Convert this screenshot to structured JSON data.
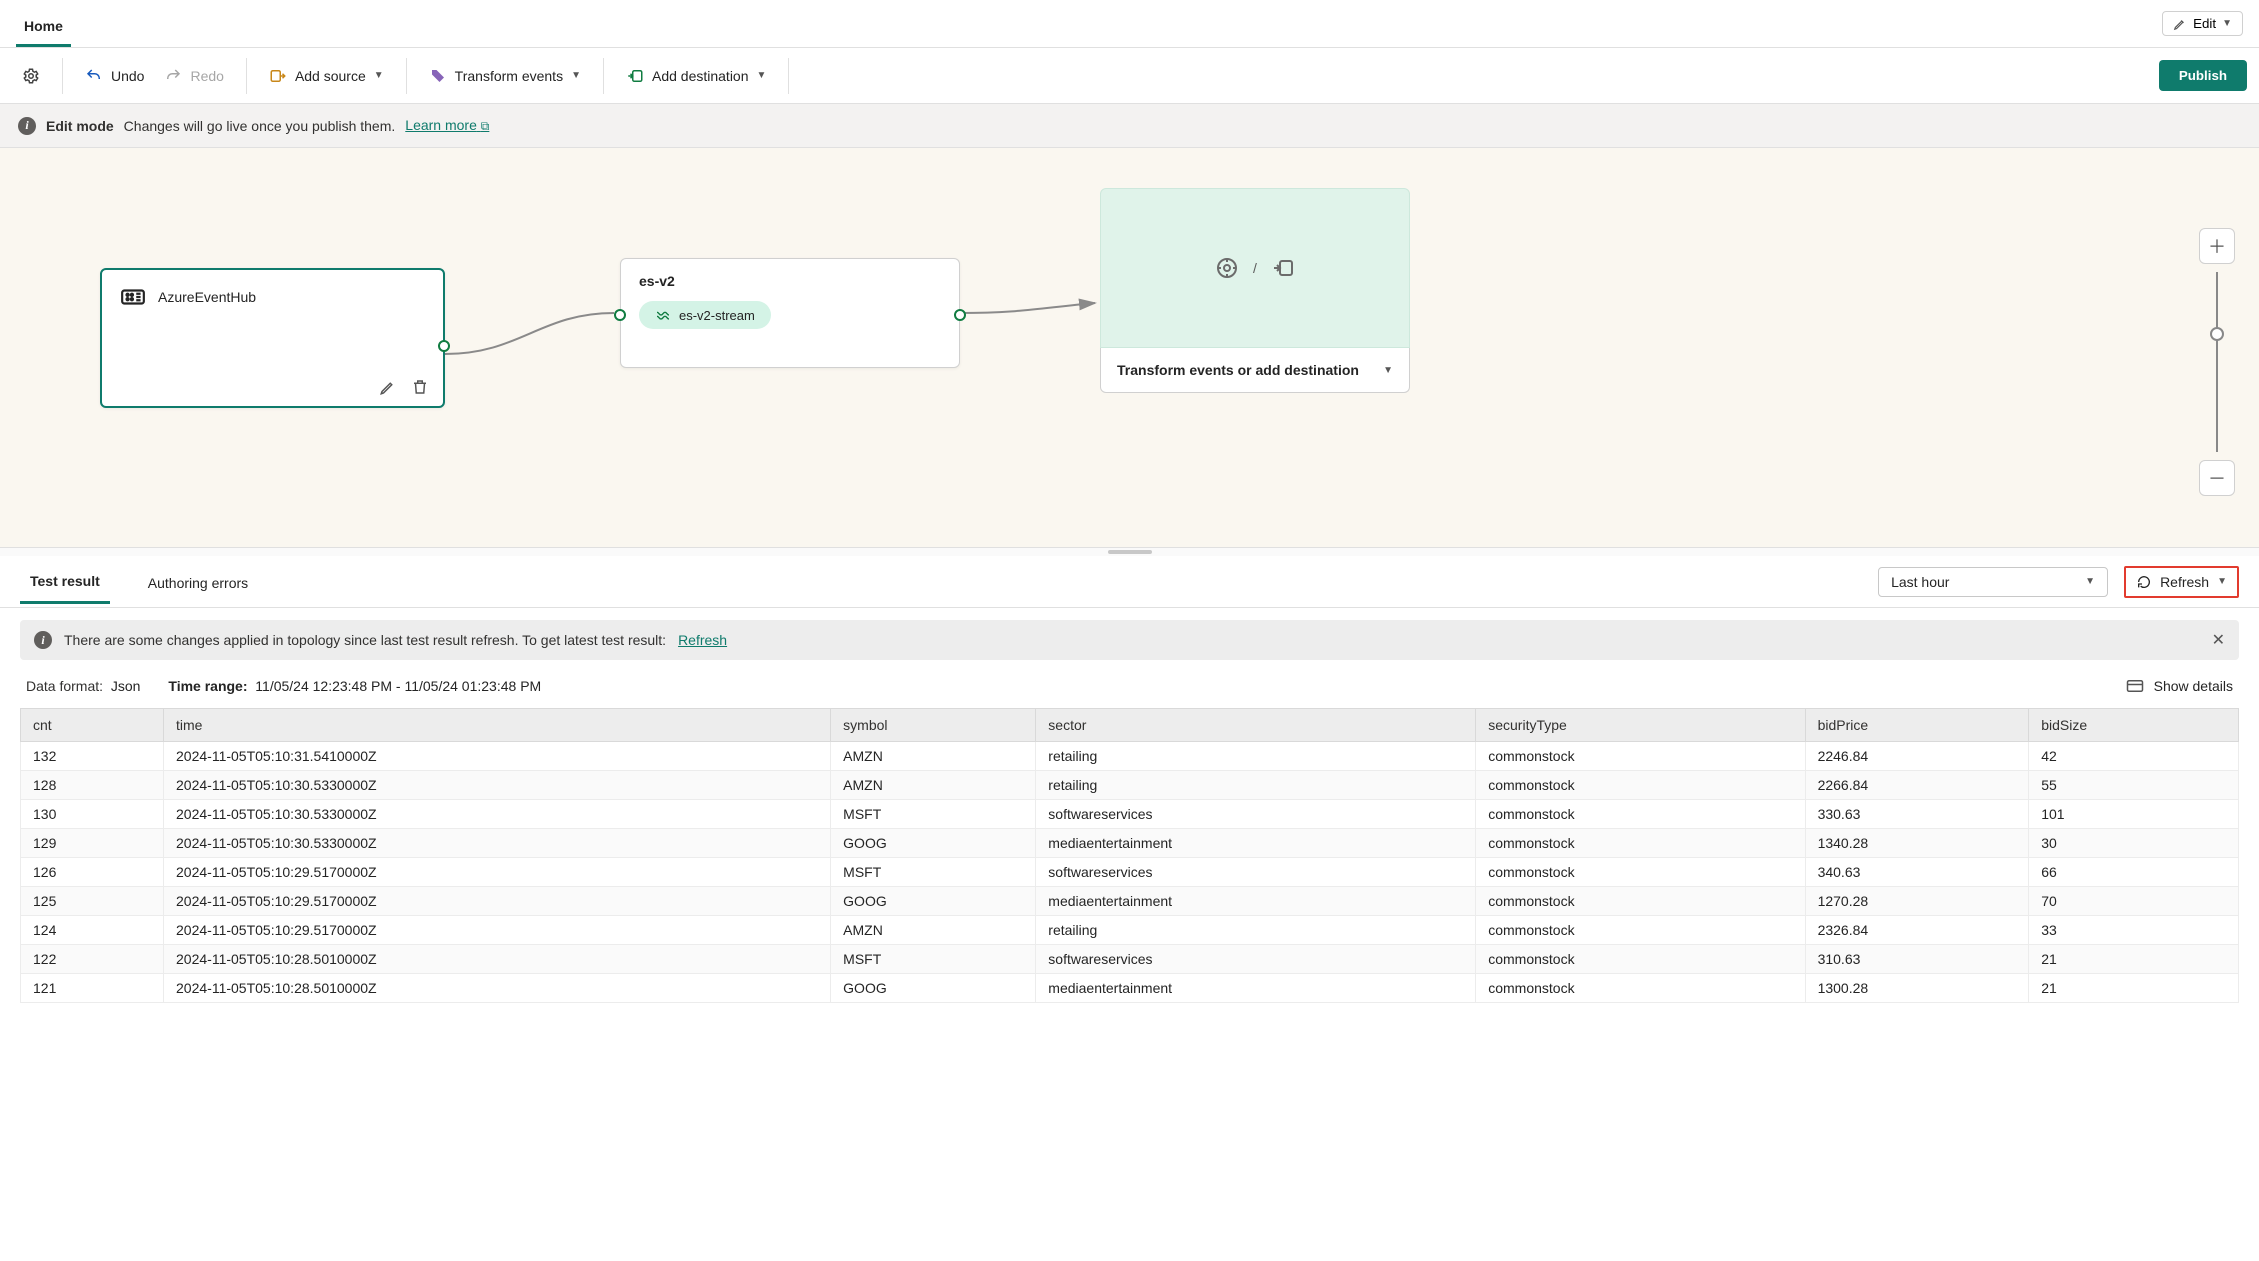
{
  "tabs": {
    "home": "Home"
  },
  "edit_button": "Edit",
  "toolbar": {
    "undo": "Undo",
    "redo": "Redo",
    "add_source": "Add source",
    "transform_events": "Transform events",
    "add_destination": "Add destination",
    "publish": "Publish"
  },
  "edit_mode_banner": {
    "title": "Edit mode",
    "text": "Changes will go live once you publish them.",
    "learn_more": "Learn more"
  },
  "canvas": {
    "source_node": {
      "title": "AzureEventHub"
    },
    "stream_node": {
      "title": "es-v2",
      "pill": "es-v2-stream"
    },
    "target_node": {
      "title": "Transform events or add destination",
      "sep": "/"
    }
  },
  "bottom_tabs": {
    "test_result": "Test result",
    "authoring_errors": "Authoring errors"
  },
  "time_dropdown": "Last hour",
  "refresh": "Refresh",
  "topology_warning": {
    "text": "There are some changes applied in topology since last test result refresh. To get latest test result:",
    "link": "Refresh"
  },
  "meta": {
    "data_format_label": "Data format:",
    "data_format_value": "Json",
    "time_range_label": "Time range:",
    "time_range_value": "11/05/24 12:23:48 PM - 11/05/24 01:23:48 PM",
    "show_details": "Show details"
  },
  "table": {
    "columns": [
      "cnt",
      "time",
      "symbol",
      "sector",
      "securityType",
      "bidPrice",
      "bidSize"
    ],
    "rows": [
      [
        "132",
        "2024-11-05T05:10:31.5410000Z",
        "AMZN",
        "retailing",
        "commonstock",
        "2246.84",
        "42"
      ],
      [
        "128",
        "2024-11-05T05:10:30.5330000Z",
        "AMZN",
        "retailing",
        "commonstock",
        "2266.84",
        "55"
      ],
      [
        "130",
        "2024-11-05T05:10:30.5330000Z",
        "MSFT",
        "softwareservices",
        "commonstock",
        "330.63",
        "101"
      ],
      [
        "129",
        "2024-11-05T05:10:30.5330000Z",
        "GOOG",
        "mediaentertainment",
        "commonstock",
        "1340.28",
        "30"
      ],
      [
        "126",
        "2024-11-05T05:10:29.5170000Z",
        "MSFT",
        "softwareservices",
        "commonstock",
        "340.63",
        "66"
      ],
      [
        "125",
        "2024-11-05T05:10:29.5170000Z",
        "GOOG",
        "mediaentertainment",
        "commonstock",
        "1270.28",
        "70"
      ],
      [
        "124",
        "2024-11-05T05:10:29.5170000Z",
        "AMZN",
        "retailing",
        "commonstock",
        "2326.84",
        "33"
      ],
      [
        "122",
        "2024-11-05T05:10:28.5010000Z",
        "MSFT",
        "softwareservices",
        "commonstock",
        "310.63",
        "21"
      ],
      [
        "121",
        "2024-11-05T05:10:28.5010000Z",
        "GOOG",
        "mediaentertainment",
        "commonstock",
        "1300.28",
        "21"
      ]
    ]
  }
}
